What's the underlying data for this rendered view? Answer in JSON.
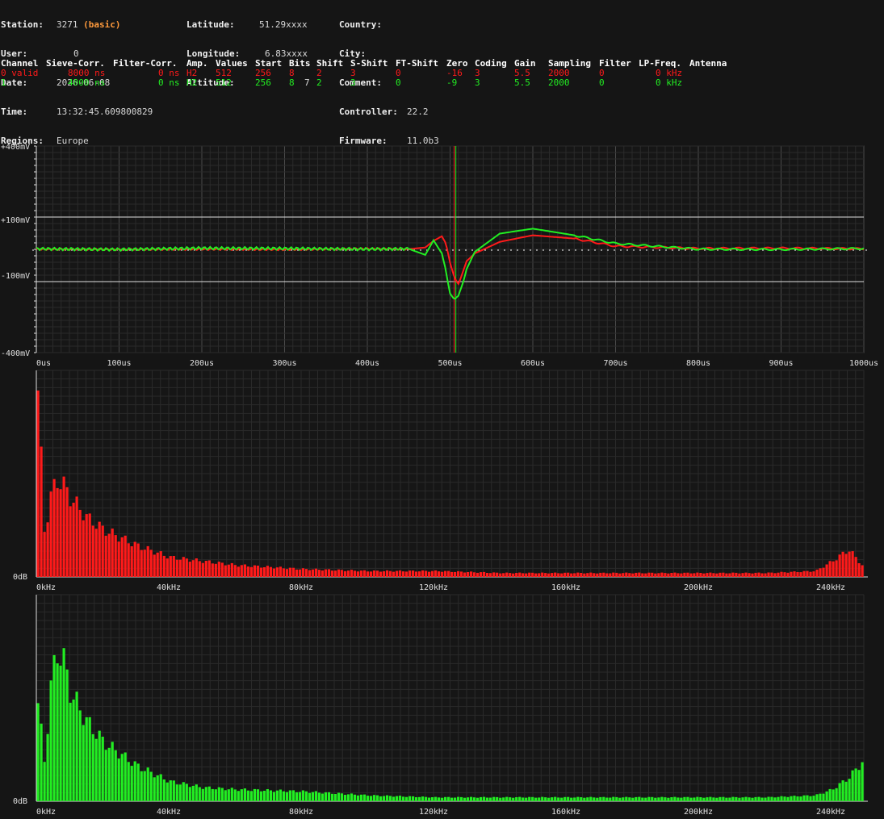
{
  "station_info": {
    "col1": [
      {
        "label": "Station:",
        "value": "3271",
        "extra": "(basic)"
      },
      {
        "label": "User:",
        "value": "0"
      },
      {
        "label": "Date:",
        "value": "2026-06-08"
      },
      {
        "label": "Time:",
        "value": "13:32:45.609800829"
      },
      {
        "label": "Regions:",
        "value": "Europe"
      }
    ],
    "col2": [
      {
        "label": "Latitude:",
        "value": "51.29xxxx"
      },
      {
        "label": "Longitude:",
        "value": "6.83xxxx"
      },
      {
        "label": "Altitude:",
        "value": "7"
      }
    ],
    "col3": [
      {
        "label": "Country:",
        "value": ""
      },
      {
        "label": "City:",
        "value": ""
      },
      {
        "label": "Comment:",
        "value": ""
      },
      {
        "label": "Controller:",
        "value": "22.2"
      },
      {
        "label": "Firmware:",
        "value": "11.0b3"
      }
    ]
  },
  "channel_table": {
    "headers": [
      "Channel",
      "Sieve-Corr.",
      "Filter-Corr.",
      "Amp.",
      "Values",
      "Start",
      "Bits",
      "Shift",
      "S-Shift",
      "FT-Shift",
      "Zero",
      "Coding",
      "Gain",
      "Sampling",
      "Filter",
      "LP-Freq.",
      "Antenna"
    ],
    "rows": [
      {
        "color": "red",
        "cells": [
          "0 valid",
          "8000 ns",
          "0 ns",
          "H2",
          "512",
          "256",
          "8",
          "2",
          "3",
          "0",
          "-16",
          "3",
          "5.5",
          "2000",
          "0",
          "0 kHz",
          ""
        ]
      },
      {
        "color": "green",
        "cells": [
          "1",
          "4000 ns",
          "0 ns",
          "H2",
          "512",
          "256",
          "8",
          "2",
          "3",
          "0",
          "-9",
          "3",
          "5.5",
          "2000",
          "0",
          "0 kHz",
          ""
        ]
      }
    ]
  },
  "colors": {
    "channel0": "#ff1a1a",
    "channel1": "#22ee22",
    "grid": "#3a3a3a",
    "background": "#151515"
  },
  "waveform": {
    "y_labels": [
      "+400mV",
      "+100mV",
      "-100mV",
      "-400mV"
    ],
    "x_labels": [
      "0us",
      "100us",
      "200us",
      "300us",
      "400us",
      "500us",
      "600us",
      "700us",
      "800us",
      "900us",
      "1000us"
    ]
  },
  "spectrum_red": {
    "y_label": "0dB",
    "x_labels": [
      "0kHz",
      "40kHz",
      "80kHz",
      "120kHz",
      "160kHz",
      "200kHz",
      "240kHz"
    ]
  },
  "spectrum_green": {
    "y_label": "0dB",
    "x_labels": [
      "0kHz",
      "40kHz",
      "80kHz",
      "120kHz",
      "160kHz",
      "200kHz",
      "240kHz"
    ]
  },
  "chart_data": [
    {
      "type": "line",
      "x_unit": "us",
      "y_unit": "mV",
      "xlim": [
        0,
        1000
      ],
      "ylim": [
        -400,
        400
      ],
      "series": [
        {
          "color": "#ff1a1a",
          "x": [
            0,
            100,
            200,
            300,
            400,
            450,
            470,
            480,
            490,
            495,
            500,
            505,
            510,
            520,
            530,
            560,
            600,
            650,
            700,
            800,
            900,
            1000
          ],
          "y": [
            3,
            2,
            3,
            2,
            4,
            3,
            8,
            28,
            42,
            20,
            -40,
            -85,
            -110,
            -35,
            -10,
            25,
            45,
            35,
            12,
            5,
            6,
            4
          ]
        },
        {
          "color": "#22ee22",
          "x": [
            0,
            100,
            200,
            300,
            400,
            450,
            470,
            480,
            490,
            495,
            500,
            505,
            510,
            520,
            530,
            560,
            600,
            650,
            700,
            800,
            900,
            1000
          ],
          "y": [
            4,
            2,
            6,
            5,
            3,
            4,
            -15,
            30,
            -10,
            -65,
            -150,
            -175,
            -160,
            -60,
            -5,
            50,
            65,
            45,
            20,
            3,
            2,
            5
          ]
        }
      ]
    },
    {
      "type": "bar",
      "x_unit": "kHz",
      "xlim": [
        0,
        250
      ],
      "name": "",
      "color": "#ff1a1a",
      "x": [
        0,
        2,
        4,
        6,
        8,
        10,
        15,
        20,
        30,
        40,
        50,
        60,
        80,
        100,
        120,
        140,
        160,
        180,
        200,
        220,
        235,
        240,
        245,
        249
      ],
      "values": [
        95,
        22,
        42,
        50,
        46,
        40,
        30,
        24,
        16,
        10,
        8,
        6,
        4,
        3,
        3,
        2,
        2,
        2,
        2,
        2,
        3,
        8,
        14,
        6
      ]
    },
    {
      "type": "bar",
      "x_unit": "kHz",
      "xlim": [
        0,
        250
      ],
      "name": "",
      "color": "#22ee22",
      "x": [
        0,
        2,
        4,
        6,
        8,
        10,
        15,
        20,
        30,
        40,
        50,
        60,
        80,
        100,
        120,
        140,
        160,
        180,
        200,
        220,
        235,
        240,
        245,
        249
      ],
      "values": [
        50,
        20,
        60,
        78,
        70,
        55,
        40,
        30,
        18,
        10,
        7,
        6,
        5,
        3,
        2,
        2,
        2,
        2,
        2,
        2,
        3,
        6,
        12,
        20
      ]
    }
  ]
}
